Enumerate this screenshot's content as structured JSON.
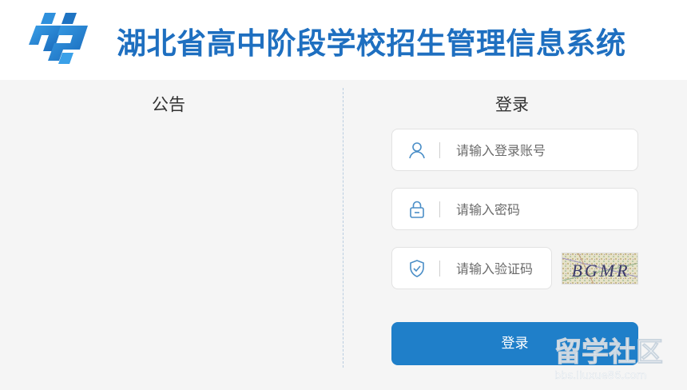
{
  "header": {
    "title": "湖北省高中阶段学校招生管理信息系统",
    "logo_icon": "hp-logo-icon",
    "brand_color": "#1e6fc0"
  },
  "notice": {
    "title": "公告"
  },
  "login": {
    "title": "登录",
    "username": {
      "placeholder": "请输入登录账号",
      "icon": "user-icon"
    },
    "password": {
      "placeholder": "请输入密码",
      "icon": "lock-icon"
    },
    "captcha": {
      "placeholder": "请输入验证码",
      "icon": "shield-check-icon",
      "code": "BGMR"
    },
    "submit_label": "登录",
    "button_color": "#1f7fc9"
  },
  "watermark": {
    "brand": "留学社区",
    "url": "bbs.liuxue86.com"
  }
}
